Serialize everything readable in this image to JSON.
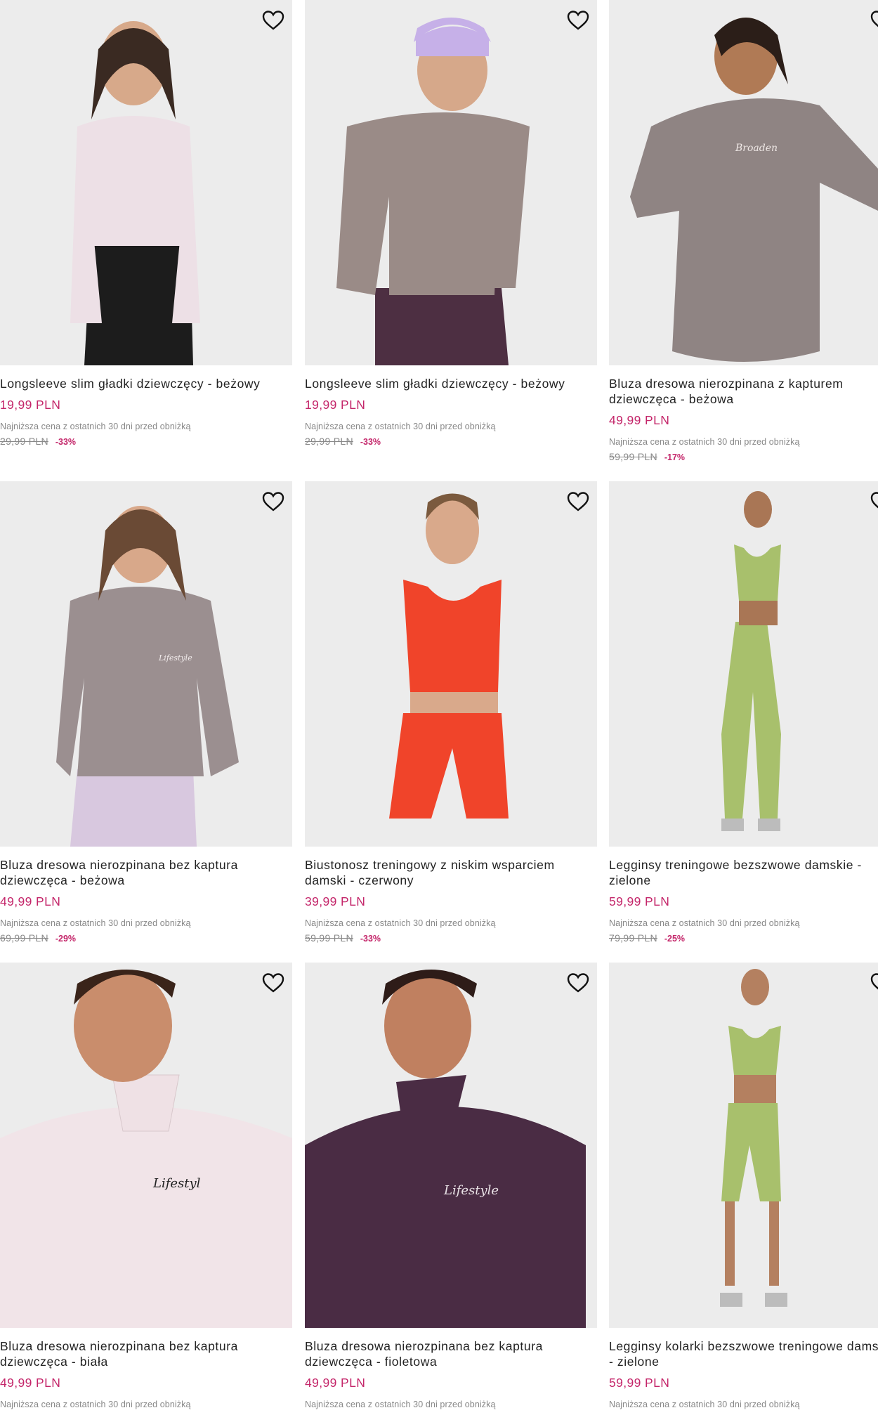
{
  "colors": {
    "price": "#c4266a",
    "muted": "#888888",
    "photo_bg": "#ececec"
  },
  "products": [
    {
      "name": "Longsleeve slim gładki dziewczęcy - beżowy",
      "price": "19,99 PLN",
      "lowest_note": "Najniższa cena z ostatnich 30 dni przed obniżką",
      "old_price": "29,99 PLN",
      "discount": "-33%",
      "icon": "heart-outline-icon"
    },
    {
      "name": "Longsleeve slim gładki dziewczęcy - beżowy",
      "price": "19,99 PLN",
      "lowest_note": "Najniższa cena z ostatnich 30 dni przed obniżką",
      "old_price": "29,99 PLN",
      "discount": "-33%",
      "icon": "heart-outline-icon"
    },
    {
      "name": "Bluza dresowa nierozpinana z kapturem dziewczęca - beżowa",
      "price": "49,99 PLN",
      "lowest_note": "Najniższa cena z ostatnich 30 dni przed obniżką",
      "old_price": "59,99 PLN",
      "discount": "-17%",
      "icon": "heart-outline-icon"
    },
    {
      "name": "Bluza dresowa nierozpinana bez kaptura dziewczęca - beżowa",
      "price": "49,99 PLN",
      "lowest_note": "Najniższa cena z ostatnich 30 dni przed obniżką",
      "old_price": "69,99 PLN",
      "discount": "-29%",
      "icon": "heart-outline-icon"
    },
    {
      "name": "Biustonosz treningowy z niskim wsparciem damski - czerwony",
      "price": "39,99 PLN",
      "lowest_note": "Najniższa cena z ostatnich 30 dni przed obniżką",
      "old_price": "59,99 PLN",
      "discount": "-33%",
      "icon": "heart-outline-icon"
    },
    {
      "name": "Legginsy treningowe bezszwowe damskie - zielone",
      "price": "59,99 PLN",
      "lowest_note": "Najniższa cena z ostatnich 30 dni przed obniżką",
      "old_price": "79,99 PLN",
      "discount": "-25%",
      "icon": "heart-outline-icon"
    },
    {
      "name": "Bluza dresowa nierozpinana bez kaptura dziewczęca - biała",
      "price": "49,99 PLN",
      "lowest_note": "Najniższa cena z ostatnich 30 dni przed obniżką",
      "old_price": "",
      "discount": "",
      "icon": "heart-outline-icon"
    },
    {
      "name": "Bluza dresowa nierozpinana bez kaptura dziewczęca - fioletowa",
      "price": "49,99 PLN",
      "lowest_note": "Najniższa cena z ostatnich 30 dni przed obniżką",
      "old_price": "",
      "discount": "",
      "icon": "heart-outline-icon"
    },
    {
      "name": "Legginsy kolarki bezszwowe treningowe damskie - zielone",
      "price": "59,99 PLN",
      "lowest_note": "Najniższa cena z ostatnich 30 dni przed obniżką",
      "old_price": "",
      "discount": "",
      "icon": "heart-outline-icon"
    }
  ]
}
